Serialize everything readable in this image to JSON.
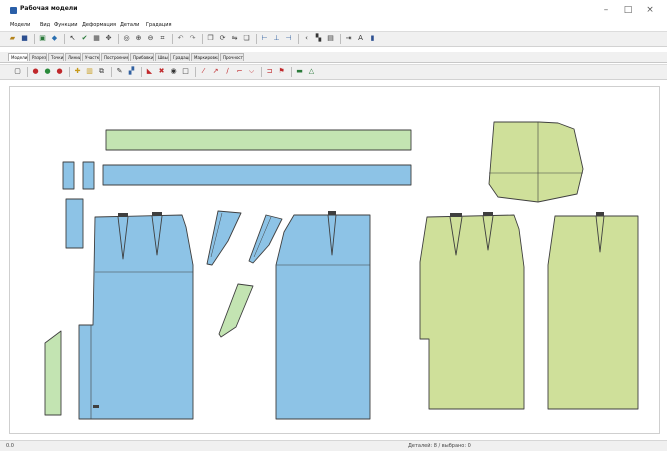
{
  "window": {
    "title": "Рабочая модели",
    "minimize": "–",
    "maximize": "□",
    "close": "×"
  },
  "menu": [
    "Модели",
    "Вид",
    "Функции",
    "Деформация",
    "Детали",
    "Градация"
  ],
  "toolbar1": [
    "folder-open-icon",
    "save-icon",
    "sep",
    "new-icon",
    "pattern-icon",
    "sep",
    "select-icon",
    "check-icon",
    "grid-icon",
    "move-icon",
    "sep",
    "zoom-icon",
    "zoom-in-icon",
    "zoom-out-icon",
    "zoom-fit-icon",
    "sep",
    "undo-icon",
    "redo-icon",
    "sep",
    "copy-icon",
    "rotate-icon",
    "mirror-icon",
    "paste-icon",
    "sep",
    "align-left-icon",
    "align-center-icon",
    "align-right-icon",
    "sep",
    "cursor-icon",
    "fill-icon",
    "print-icon",
    "sep",
    "export-icon",
    "text-icon",
    "info-icon"
  ],
  "tabs": [
    "Модели",
    "Разрез",
    "Точки",
    "Линии",
    "Участки",
    "Построение",
    "Прибавки",
    "Швы",
    "Градация",
    "Маркировка",
    "Прочности"
  ],
  "toolbar2": [
    "page-icon",
    "sep",
    "red-dot-icon",
    "green-dot-icon",
    "red-dot-icon",
    "sep",
    "move-detail-icon",
    "resize-icon",
    "copy-detail-icon",
    "sep",
    "pencil-icon",
    "ruler-icon",
    "sep",
    "cut-icon",
    "delete-icon",
    "point-icon",
    "frame-icon",
    "sep",
    "line-icon",
    "arrow-icon",
    "slash-icon",
    "corner-icon",
    "hook-icon",
    "sep",
    "bracket-icon",
    "flag-icon",
    "sep",
    "layers-icon",
    "triangle-icon"
  ],
  "status": {
    "left": "0.0",
    "right": "Деталей: 8 / выбрано: 0"
  },
  "colors": {
    "blue_piece": "#8dc3e6",
    "green_piece": "#cfe09a",
    "light_green_piece": "#c3e4b2",
    "outline": "#3f3f3f"
  }
}
